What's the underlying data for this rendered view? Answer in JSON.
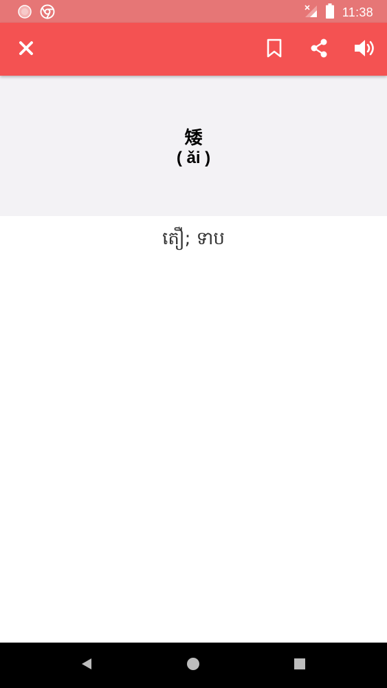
{
  "status_bar": {
    "time": "11:38",
    "icons": [
      "notification-dot-icon",
      "chrome-icon",
      "no-signal-icon",
      "battery-icon"
    ]
  },
  "app_bar": {
    "background": "#f45252",
    "actions": [
      "close-icon",
      "bookmark-icon",
      "share-icon",
      "volume-icon"
    ]
  },
  "word": {
    "hanzi": "矮",
    "pinyin": "( ǎi )",
    "translation": "តឿ; ទាប"
  },
  "nav_bar": {
    "buttons": [
      "back-icon",
      "home-icon",
      "recents-icon"
    ]
  }
}
